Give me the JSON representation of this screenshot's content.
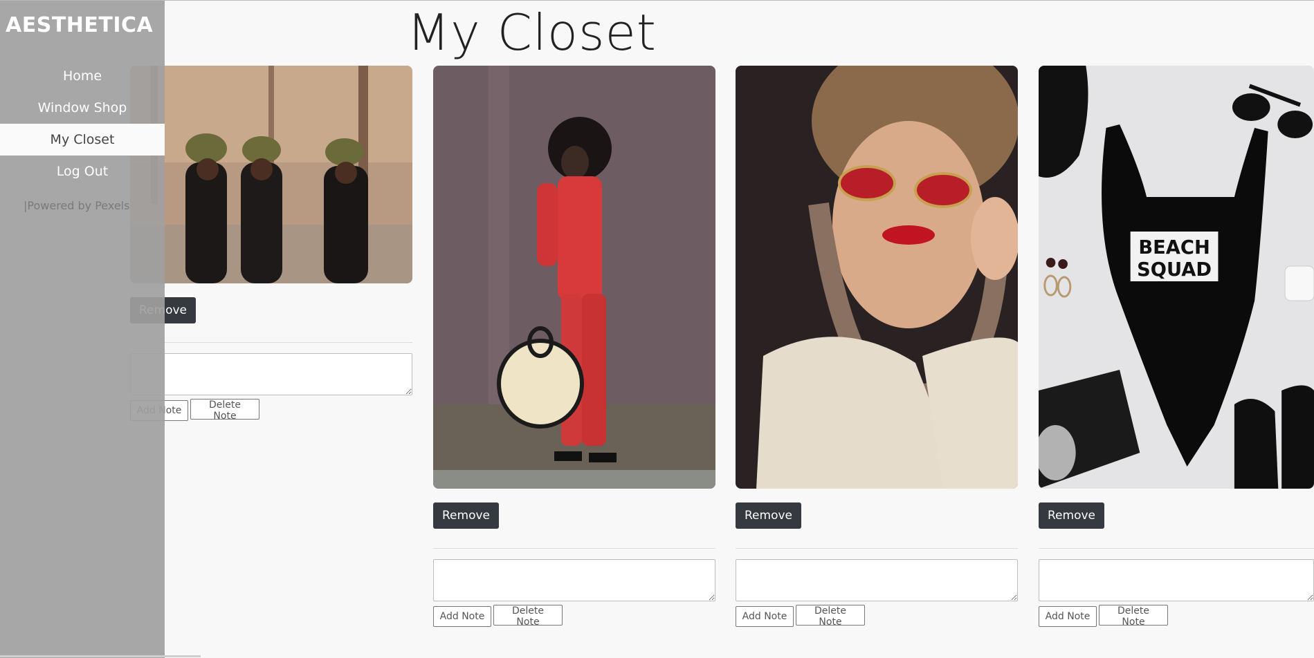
{
  "page": {
    "title": "My Closet"
  },
  "sidebar": {
    "brand": "AESTHETICA",
    "items": [
      {
        "label": "Home",
        "active": false
      },
      {
        "label": "Window Shop",
        "active": false
      },
      {
        "label": "My Closet",
        "active": true
      },
      {
        "label": "Log Out",
        "active": false
      }
    ],
    "credit": "|Powered by Pexels"
  },
  "cards": [
    {
      "image": "three-women-in-headwraps-forest",
      "remove_label": "Remove",
      "note_value": "",
      "add_note_label": "Add Note",
      "delete_note_label": "Delete Note"
    },
    {
      "image": "woman-red-outfit-round-bag",
      "remove_label": "Remove",
      "note_value": "",
      "add_note_label": "Add Note",
      "delete_note_label": "Delete Note"
    },
    {
      "image": "woman-red-sunglasses-headscarf",
      "remove_label": "Remove",
      "note_value": "",
      "add_note_label": "Add Note",
      "delete_note_label": "Delete Note"
    },
    {
      "image": "black-swimsuit-beach-squad-flatlay",
      "image_text": "BEACH SQUAD",
      "remove_label": "Remove",
      "note_value": "",
      "add_note_label": "Add Note",
      "delete_note_label": "Delete Note"
    }
  ],
  "colors": {
    "overlay": "#a0a0a0",
    "button_dark": "#343a40",
    "background": "#f8f8f8"
  }
}
